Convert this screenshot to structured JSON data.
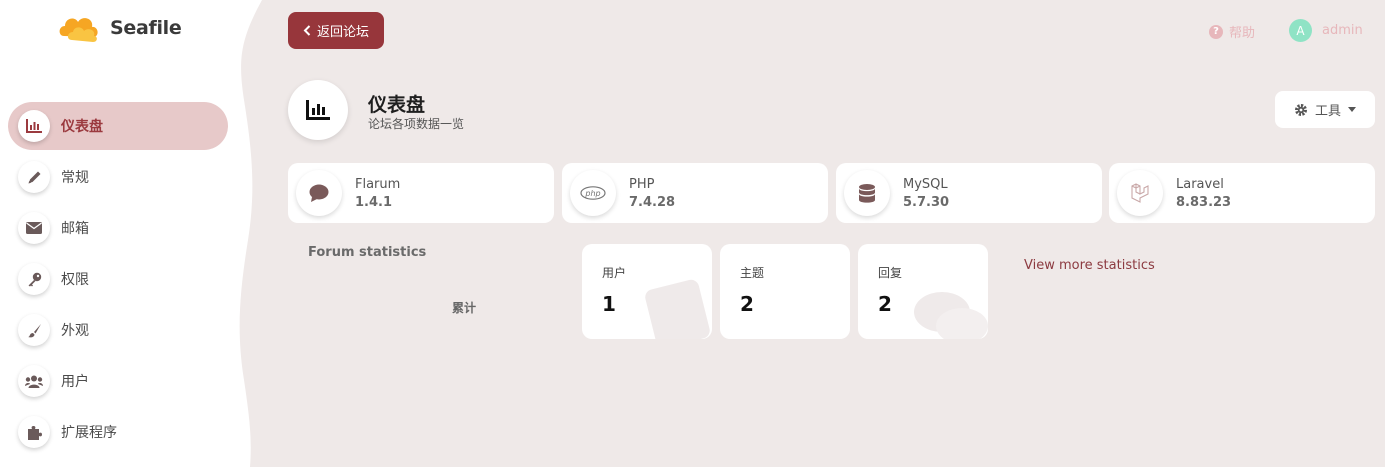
{
  "app": {
    "logo_text": "Seafile"
  },
  "sidebar": {
    "items": [
      {
        "label": "仪表盘",
        "icon": "dashboard-icon",
        "active": true
      },
      {
        "label": "常规",
        "icon": "pencil-icon"
      },
      {
        "label": "邮箱",
        "icon": "envelope-icon"
      },
      {
        "label": "权限",
        "icon": "key-icon"
      },
      {
        "label": "外观",
        "icon": "paintbrush-icon"
      },
      {
        "label": "用户",
        "icon": "users-icon"
      },
      {
        "label": "扩展程序",
        "icon": "puzzle-icon"
      }
    ]
  },
  "header": {
    "back_label": "返回论坛",
    "help_label": "帮助",
    "username": "admin",
    "avatar_letter": "A"
  },
  "page": {
    "title": "仪表盘",
    "subtitle": "论坛各项数据一览",
    "tools_label": "工具"
  },
  "versions": [
    {
      "name": "Flarum",
      "value": "1.4.1",
      "icon": "comment-icon"
    },
    {
      "name": "PHP",
      "value": "7.4.28",
      "icon": "php-icon"
    },
    {
      "name": "MySQL",
      "value": "5.7.30",
      "icon": "database-icon"
    },
    {
      "name": "Laravel",
      "value": "8.83.23",
      "icon": "laravel-icon"
    }
  ],
  "stats": {
    "heading": "Forum statistics",
    "period": "累计",
    "cards": [
      {
        "label": "用户",
        "value": "1"
      },
      {
        "label": "主题",
        "value": "2"
      },
      {
        "label": "回复",
        "value": "2"
      }
    ],
    "more_link": "View more statistics"
  },
  "colors": {
    "accent": "#97363b",
    "active_nav_bg": "#e7c9c9",
    "page_bg": "#efe9e8",
    "avatar_bg": "#8fe3c5"
  }
}
